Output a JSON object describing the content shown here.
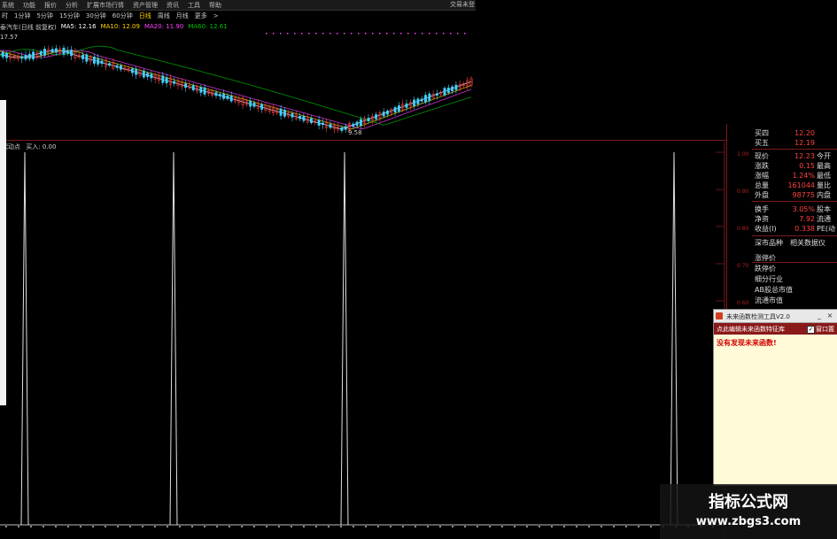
{
  "menu": {
    "items": [
      "系统",
      "功能",
      "报价",
      "分析",
      "扩展市场行情",
      "资产管理",
      "资讯",
      "工具",
      "帮助"
    ],
    "right_label": "交易未登"
  },
  "periods": {
    "items": [
      "时",
      "1分钟",
      "5分钟",
      "15分钟",
      "30分钟",
      "60分钟",
      "日线",
      "周线",
      "月线",
      "更多",
      ">"
    ],
    "active": "日线"
  },
  "ma_legend": {
    "title": "泰汽车(日线 前复权)",
    "ma5": "MA5: 12.16",
    "ma10": "MA10: 12.09",
    "ma20": "MA20: 11.90",
    "ma60": "MA60: 12.61",
    "colors": {
      "ma5": "#ffffff",
      "ma10": "#ffd400",
      "ma20": "#ff40ff",
      "ma60": "#00c000"
    }
  },
  "price_labels": {
    "high": "17.57",
    "low": "9.58"
  },
  "indicator": {
    "name": "起动点",
    "buy_label": "买入: 0.00"
  },
  "ind_axis": [
    "1.00",
    "0.90",
    "0.80",
    "0.70",
    "0.60"
  ],
  "signal_bars_x": [
    28,
    196,
    389,
    761
  ],
  "quote": {
    "rows": [
      {
        "label": "买四",
        "value": "12.20",
        "label2": ""
      },
      {
        "label": "买五",
        "value": "12.19",
        "label2": ""
      },
      {
        "label": "现价",
        "value": "12.23",
        "label2": "今开"
      },
      {
        "label": "涨跌",
        "value": "0.15",
        "label2": "最高"
      },
      {
        "label": "涨幅",
        "value": "1.24%",
        "label2": "最低"
      },
      {
        "label": "总量",
        "value": "161044",
        "label2": "量比"
      },
      {
        "label": "外盘",
        "value": "98775",
        "label2": "内盘"
      },
      {
        "label": "换手",
        "value": "3.05%",
        "label2": "股本"
      },
      {
        "label": "净资",
        "value": "7.92",
        "label2": "流通"
      },
      {
        "label": "收益(I)",
        "value": "0.338",
        "label2": "PE(动"
      }
    ],
    "links": [
      "深市品种",
      "相关数据仪"
    ],
    "info": [
      "涨停价",
      "跌停价",
      "细分行业",
      "AB股总市值",
      "流通市值"
    ]
  },
  "popup": {
    "title": "未来函数检测工具V2.0",
    "bar_text": "点此编辑未来函数特征库",
    "checkbox_label": "窗口置",
    "message": "没有发现未来函数!",
    "min": "_",
    "close": "×"
  },
  "watermark": {
    "line1": "指标公式网",
    "line2": "www.zbgs3.com"
  }
}
